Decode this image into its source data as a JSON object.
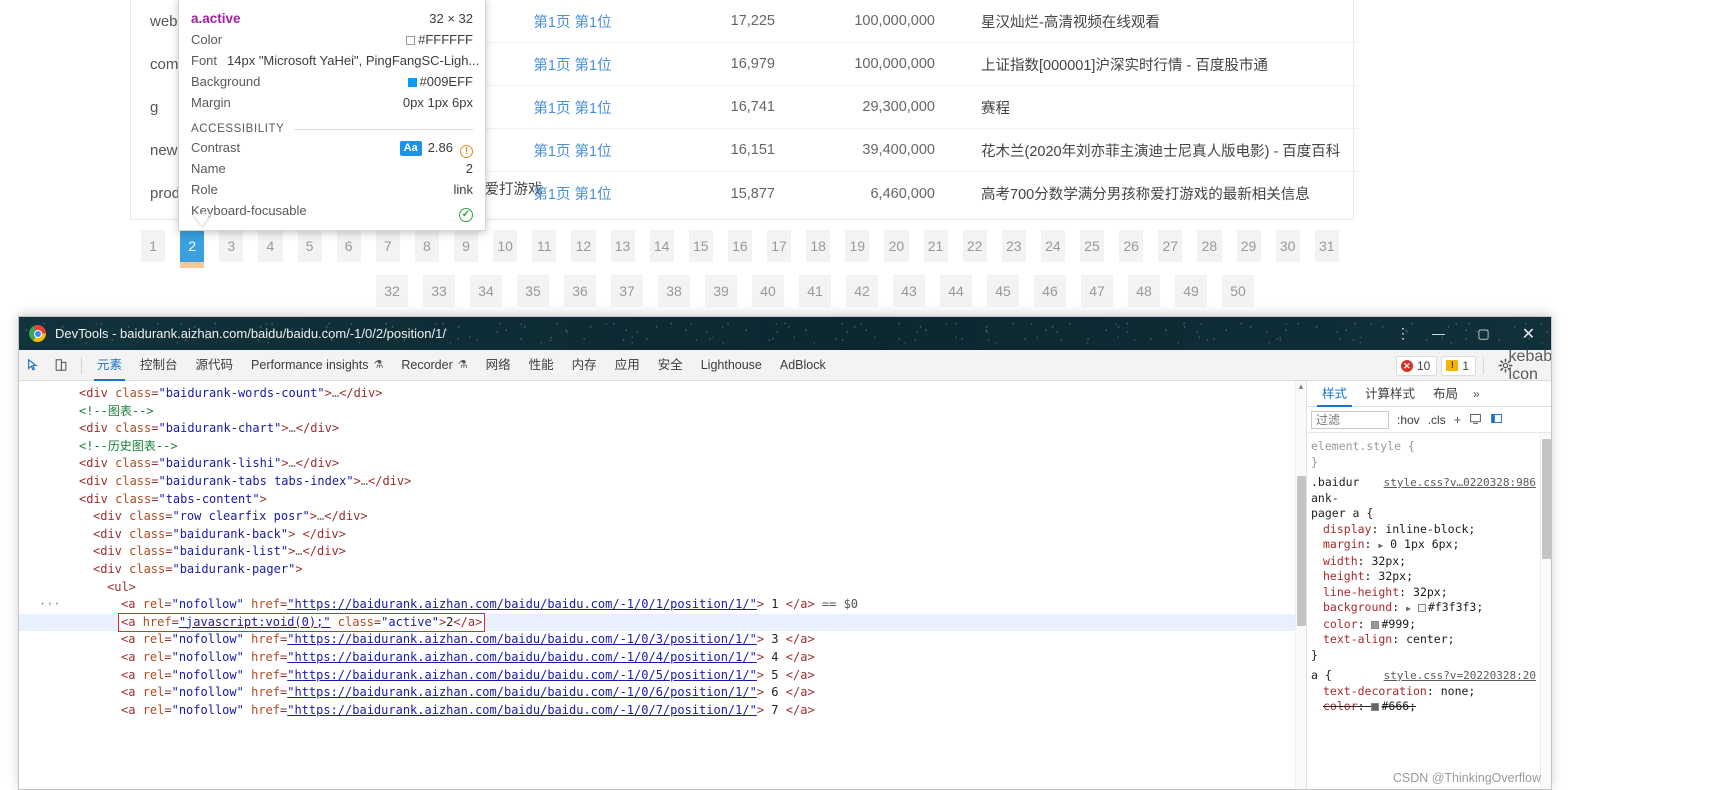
{
  "page": {
    "left_labels": [
      "web",
      "com",
      "g",
      "news",
      "prod"
    ],
    "fragment_text": "称爱打游戏",
    "table": {
      "rows": [
        {
          "position": "第1页 第1位",
          "rank": "17,225",
          "volume": "100,000,000",
          "title": "星汉灿烂-高清视频在线观看"
        },
        {
          "position": "第1页 第1位",
          "rank": "16,979",
          "volume": "100,000,000",
          "title": "上证指数[000001]沪深实时行情 - 百度股市通"
        },
        {
          "position": "第1页 第1位",
          "rank": "16,741",
          "volume": "29,300,000",
          "title": "赛程"
        },
        {
          "position": "第1页 第1位",
          "rank": "16,151",
          "volume": "39,400,000",
          "title": "花木兰(2020年刘亦菲主演迪士尼真人版电影) - 百度百科"
        },
        {
          "position": "第1页 第1位",
          "rank": "15,877",
          "volume": "6,460,000",
          "title": "高考700分数学满分男孩称爱打游戏的最新相关信息"
        }
      ]
    },
    "pager": {
      "row1": [
        "1",
        "2",
        "3",
        "4",
        "5",
        "6",
        "7",
        "8",
        "9",
        "10",
        "11",
        "12",
        "13",
        "14",
        "15",
        "16",
        "17",
        "18",
        "19",
        "20",
        "21",
        "22",
        "23",
        "24",
        "25",
        "26",
        "27",
        "28",
        "29",
        "30",
        "31"
      ],
      "row2": [
        "32",
        "33",
        "34",
        "35",
        "36",
        "37",
        "38",
        "39",
        "40",
        "41",
        "42",
        "43",
        "44",
        "45",
        "46",
        "47",
        "48",
        "49",
        "50"
      ],
      "active": "2"
    }
  },
  "tooltip": {
    "selector": "a.active",
    "dimensions": "32 × 32",
    "rows": [
      {
        "key": "Color",
        "value": "#FFFFFF",
        "swatch": "#FFFFFF"
      },
      {
        "key": "Background",
        "value": "#009EFF",
        "swatch": "#009EFF"
      },
      {
        "key": "Margin",
        "value": "0px 1px 6px"
      }
    ],
    "font_key": "Font",
    "font_value": "14px \"Microsoft YaHei\", PingFangSC-Ligh...",
    "color_key": "Color",
    "color_value": "#FFFFFF",
    "background_key": "Background",
    "background_value": "#009EFF",
    "margin_key": "Margin",
    "margin_value": "0px 1px 6px",
    "a11y_heading": "ACCESSIBILITY",
    "contrast_key": "Contrast",
    "contrast_badge": "Aa",
    "contrast_value": "2.86",
    "name_key": "Name",
    "name_value": "2",
    "role_key": "Role",
    "role_value": "link",
    "keyboard_key": "Keyboard-focusable",
    "keyboard_value": "✓"
  },
  "devtools": {
    "window_title": "DevTools - baidurank.aizhan.com/baidu/baidu.com/-1/0/2/position/1/",
    "window_controls": {
      "kebab": "⋮",
      "minimize": "—",
      "maximize": "▢",
      "close": "✕"
    },
    "toolbar": {
      "inspect_icon": "inspect-cursor",
      "device_icon": "device-toolbar",
      "tabs": [
        {
          "label": "元素",
          "selected": true,
          "flask": false
        },
        {
          "label": "控制台",
          "selected": false,
          "flask": false
        },
        {
          "label": "源代码",
          "selected": false,
          "flask": false
        },
        {
          "label": "Performance insights",
          "selected": false,
          "flask": true
        },
        {
          "label": "Recorder",
          "selected": false,
          "flask": true
        },
        {
          "label": "网络",
          "selected": false,
          "flask": false
        },
        {
          "label": "性能",
          "selected": false,
          "flask": false
        },
        {
          "label": "内存",
          "selected": false,
          "flask": false
        },
        {
          "label": "应用",
          "selected": false,
          "flask": false
        },
        {
          "label": "安全",
          "selected": false,
          "flask": false
        },
        {
          "label": "Lighthouse",
          "selected": false,
          "flask": false
        },
        {
          "label": "AdBlock",
          "selected": false,
          "flask": false
        }
      ],
      "error_count": "10",
      "warning_count": "1",
      "settings_icon": "gear-icon",
      "more_icon": "kebab-icon"
    },
    "dom": {
      "lines": [
        {
          "indent": 1,
          "tri": "closed",
          "html": "<span class=\"tg\">&lt;div </span><span class=\"at\">class</span><span class=\"tg\">=</span><span class=\"av\">\"baidurank-words-count\"</span><span class=\"tg\">&gt;</span><span class=\"ell\">…</span><span class=\"tg\">&lt;/div&gt;</span>"
        },
        {
          "indent": 1,
          "tri": "none",
          "html": "<span class=\"cm\">&lt;!--图表--&gt;</span>"
        },
        {
          "indent": 1,
          "tri": "closed",
          "html": "<span class=\"tg\">&lt;div </span><span class=\"at\">class</span><span class=\"tg\">=</span><span class=\"av\">\"baidurank-chart\"</span><span class=\"tg\">&gt;</span><span class=\"ell\">…</span><span class=\"tg\">&lt;/div&gt;</span>"
        },
        {
          "indent": 1,
          "tri": "none",
          "html": "<span class=\"cm\">&lt;!--历史图表--&gt;</span>"
        },
        {
          "indent": 1,
          "tri": "closed",
          "html": "<span class=\"tg\">&lt;div </span><span class=\"at\">class</span><span class=\"tg\">=</span><span class=\"av\">\"baidurank-lishi\"</span><span class=\"tg\">&gt;</span><span class=\"ell\">…</span><span class=\"tg\">&lt;/div&gt;</span>"
        },
        {
          "indent": 1,
          "tri": "closed",
          "html": "<span class=\"tg\">&lt;div </span><span class=\"at\">class</span><span class=\"tg\">=</span><span class=\"av\">\"baidurank-tabs tabs-index\"</span><span class=\"tg\">&gt;</span><span class=\"ell\">…</span><span class=\"tg\">&lt;/div&gt;</span>"
        },
        {
          "indent": 1,
          "tri": "open",
          "html": "<span class=\"tg\">&lt;div </span><span class=\"at\">class</span><span class=\"tg\">=</span><span class=\"av\">\"tabs-content\"</span><span class=\"tg\">&gt;</span>"
        },
        {
          "indent": 2,
          "tri": "closed",
          "html": "<span class=\"tg\">&lt;div </span><span class=\"at\">class</span><span class=\"tg\">=</span><span class=\"av\">\"row clearfix posr\"</span><span class=\"tg\">&gt;</span><span class=\"ell\">…</span><span class=\"tg\">&lt;/div&gt;</span>"
        },
        {
          "indent": 2,
          "tri": "none",
          "html": "<span class=\"tg\">&lt;div </span><span class=\"at\">class</span><span class=\"tg\">=</span><span class=\"av\">\"baidurank-back\"</span><span class=\"tg\">&gt; &lt;/div&gt;</span>"
        },
        {
          "indent": 2,
          "tri": "closed",
          "html": "<span class=\"tg\">&lt;div </span><span class=\"at\">class</span><span class=\"tg\">=</span><span class=\"av\">\"baidurank-list\"</span><span class=\"tg\">&gt;</span><span class=\"ell\">…</span><span class=\"tg\">&lt;/div&gt;</span>"
        },
        {
          "indent": 2,
          "tri": "open",
          "html": "<span class=\"tg\">&lt;div </span><span class=\"at\">class</span><span class=\"tg\">=</span><span class=\"av\">\"baidurank-pager\"</span><span class=\"tg\">&gt;</span>"
        },
        {
          "indent": 3,
          "tri": "open",
          "html": "<span class=\"tg\">&lt;ul&gt;</span>"
        },
        {
          "indent": 4,
          "tri": "none",
          "dots": true,
          "html": "<span class=\"tg\">&lt;a </span><span class=\"at\">rel</span><span class=\"tg\">=</span><span class=\"av\">\"nofollow\"</span> <span class=\"at\">href</span><span class=\"tg\">=</span><span class=\"av lnk\">\"https://baidurank.aizhan.com/baidu/baidu.com/-1/0/1/position/1/\"</span><span class=\"tg\">&gt;</span> 1 <span class=\"tg\">&lt;/a&gt;</span> <span class=\"eq0\">== $0</span>"
        },
        {
          "indent": 4,
          "tri": "none",
          "selected": true,
          "html": "<span class=\"sel-box\"><span class=\"tg\">&lt;a </span><span class=\"at\">href</span><span class=\"tg\">=</span><span class=\"av lnk\">\"javascript:void(0);\"</span> <span class=\"at\">class</span><span class=\"tg\">=</span><span class=\"av\">\"active\"</span><span class=\"tg\">&gt;</span>2<span class=\"tg\">&lt;/a&gt;</span></span>"
        },
        {
          "indent": 4,
          "tri": "none",
          "html": "<span class=\"tg\">&lt;a </span><span class=\"at\">rel</span><span class=\"tg\">=</span><span class=\"av\">\"nofollow\"</span> <span class=\"at\">href</span><span class=\"tg\">=</span><span class=\"av lnk\">\"https://baidurank.aizhan.com/baidu/baidu.com/-1/0/3/position/1/\"</span><span class=\"tg\">&gt;</span> 3 <span class=\"tg\">&lt;/a&gt;</span>"
        },
        {
          "indent": 4,
          "tri": "none",
          "html": "<span class=\"tg\">&lt;a </span><span class=\"at\">rel</span><span class=\"tg\">=</span><span class=\"av\">\"nofollow\"</span> <span class=\"at\">href</span><span class=\"tg\">=</span><span class=\"av lnk\">\"https://baidurank.aizhan.com/baidu/baidu.com/-1/0/4/position/1/\"</span><span class=\"tg\">&gt;</span> 4 <span class=\"tg\">&lt;/a&gt;</span>"
        },
        {
          "indent": 4,
          "tri": "none",
          "html": "<span class=\"tg\">&lt;a </span><span class=\"at\">rel</span><span class=\"tg\">=</span><span class=\"av\">\"nofollow\"</span> <span class=\"at\">href</span><span class=\"tg\">=</span><span class=\"av lnk\">\"https://baidurank.aizhan.com/baidu/baidu.com/-1/0/5/position/1/\"</span><span class=\"tg\">&gt;</span> 5 <span class=\"tg\">&lt;/a&gt;</span>"
        },
        {
          "indent": 4,
          "tri": "none",
          "html": "<span class=\"tg\">&lt;a </span><span class=\"at\">rel</span><span class=\"tg\">=</span><span class=\"av\">\"nofollow\"</span> <span class=\"at\">href</span><span class=\"tg\">=</span><span class=\"av lnk\">\"https://baidurank.aizhan.com/baidu/baidu.com/-1/0/6/position/1/\"</span><span class=\"tg\">&gt;</span> 6 <span class=\"tg\">&lt;/a&gt;</span>"
        },
        {
          "indent": 4,
          "tri": "none",
          "html": "<span class=\"tg\">&lt;a </span><span class=\"at\">rel</span><span class=\"tg\">=</span><span class=\"av\">\"nofollow\"</span> <span class=\"at\">href</span><span class=\"tg\">=</span><span class=\"av lnk\">\"https://baidurank.aizhan.com/baidu/baidu.com/-1/0/7/position/1/\"</span><span class=\"tg\">&gt;</span> 7 <span class=\"tg\">&lt;/a&gt;</span>"
        }
      ]
    },
    "styles": {
      "tabs": [
        {
          "label": "样式",
          "selected": true
        },
        {
          "label": "计算样式",
          "selected": false
        },
        {
          "label": "布局",
          "selected": false
        }
      ],
      "more_chevron": "»",
      "filter_placeholder": "过滤",
      "hov_label": ":hov",
      "cls_label": ".cls",
      "plus_icon": "+",
      "element_style": "element.style {",
      "element_style_close": "}",
      "rule1": {
        "selector": ".baidurank-pager a {",
        "selector_wrapped": [
          ".baidur",
          "ank-",
          "pager a {"
        ],
        "source": "style.css?v…0220328:986",
        "props": [
          {
            "name": "display",
            "value": "inline-block;"
          },
          {
            "name": "margin",
            "value": "0 1px 6px;",
            "expandable": true
          },
          {
            "name": "width",
            "value": "32px;"
          },
          {
            "name": "height",
            "value": "32px;"
          },
          {
            "name": "line-height",
            "value": "32px;"
          },
          {
            "name": "background",
            "value": "#f3f3f3;",
            "swatch": "#f3f3f3",
            "expandable": true
          },
          {
            "name": "color",
            "value": "#999;",
            "swatch": "#999999"
          },
          {
            "name": "text-align",
            "value": "center;"
          }
        ],
        "close": "}"
      },
      "rule2": {
        "selector": "a {",
        "source": "style.css?v=20220328:20",
        "props": [
          {
            "name": "text-decoration",
            "value": "none;"
          },
          {
            "name": "color",
            "value": "#666;",
            "swatch": "#666666",
            "struck": true
          }
        ]
      }
    },
    "watermark": "CSDN @ThinkingOverflow"
  }
}
